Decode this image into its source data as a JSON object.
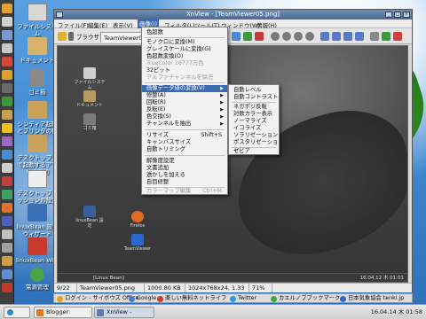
{
  "desktop": {
    "icons": [
      {
        "label": "ファイルシステム",
        "color": "#d8d8d8"
      },
      {
        "label": "ドキュメント",
        "color": "#d6b26b"
      },
      {
        "label": "ゴミ箱",
        "color": "#8a8a8a"
      },
      {
        "label": "シンティア起動とプリンタの接続",
        "color": "#c9a15a"
      },
      {
        "label": "デスクトップ上で起動するアプリの追加",
        "color": "#c9a15a"
      },
      {
        "label": "デスクトップセッションの設定",
        "color": "#eeeeee"
      },
      {
        "label": "linuxBean 設定ウィザード",
        "color": "#3b6fb6"
      },
      {
        "label": "linuxBean Wiki",
        "color": "#c83a2c"
      },
      {
        "label": "電源管理",
        "color": "#4aa344"
      }
    ]
  },
  "window": {
    "title": "XnView - [TeamViewer05.png]",
    "menus": [
      "ファイル(F)",
      "編集(E)",
      "表示(V)",
      "画像(I)",
      "フィルタ(L)",
      "ツール(T)",
      "ウィンドウ(W)",
      "情報(H)"
    ],
    "tabs": [
      "ブラウザ",
      "TeamViewer05"
    ],
    "status": {
      "index": "9/22",
      "filename": "TeamViewer05.png",
      "filesize": "1000.80 KB",
      "dimensions": "1024x768x24, 1.33",
      "zoom": "71%"
    }
  },
  "image_menu": {
    "items": [
      {
        "label": "色超数",
        "type": "normal"
      },
      {
        "label": "モノクロに変換(M)",
        "type": "normal"
      },
      {
        "label": "グレイスケールに変換(G)",
        "type": "normal"
      },
      {
        "label": "色超数変換(O)",
        "type": "normal"
      },
      {
        "label": "TrueColor 16777万色",
        "type": "disabled"
      },
      {
        "label": "32ビット",
        "type": "normal"
      },
      {
        "label": "アルファチャンネルを除去",
        "type": "disabled"
      },
      {
        "label": "画像データ値の変換(V)",
        "type": "highlight",
        "arrow": true
      },
      {
        "label": "修整(A)",
        "type": "normal",
        "arrow": true
      },
      {
        "label": "回転(R)",
        "type": "normal",
        "arrow": true
      },
      {
        "label": "反転(E)",
        "type": "normal",
        "arrow": true
      },
      {
        "label": "色交換(S)",
        "type": "normal",
        "arrow": true
      },
      {
        "label": "チャンネルを抽出",
        "type": "normal",
        "arrow": true
      },
      {
        "label": "リサイズ",
        "type": "normal",
        "shortcut": "Shift+S"
      },
      {
        "label": "キャンバスサイズ",
        "type": "normal"
      },
      {
        "label": "自動トリミング",
        "type": "normal"
      },
      {
        "label": "解像度設定",
        "type": "normal"
      },
      {
        "label": "文書追加",
        "type": "normal"
      },
      {
        "label": "透かしを加える",
        "type": "normal"
      },
      {
        "label": "自目修整",
        "type": "normal"
      },
      {
        "label": "カラーマップ編集",
        "type": "disabled",
        "shortcut": "Ctrl+M"
      }
    ]
  },
  "sub_menu": {
    "items": [
      "自動レベル",
      "自動コントラスト",
      "ネガポジ反転",
      "対数カラー表示",
      "ノーマライズ",
      "イコライズ",
      "ソラリゼーション",
      "ポスタリゼーション",
      "セピア"
    ]
  },
  "bookmarks": [
    {
      "label": "ログイン - サイボウズ Office",
      "color": "#e0a020"
    },
    {
      "label": "Google",
      "color": "#4a7ad8"
    },
    {
      "label": "楽しい無料ネットライフ",
      "color": "#d03a2a"
    },
    {
      "label": "Twitter",
      "color": "#2a9be0"
    },
    {
      "label": "カエルノブブックマーク...",
      "color": "#3caa3a"
    },
    {
      "label": "日本気象協会 tenki.jp",
      "color": "#2a6ad0"
    }
  ],
  "panel": {
    "tasks": [
      {
        "label": "Blogger: PuppyLin...",
        "color": "#e07a20"
      },
      {
        "label": "XnView - [TeamV...",
        "color": "#5a7ab0"
      }
    ],
    "clock": "16.04.14 木 01:58"
  },
  "inner_screen": {
    "icons": [
      "ファイルシステム",
      "ドキュメント",
      "ゴミ箱",
      "linuxBean 設定",
      "TeamViewer",
      "Firefox"
    ],
    "taskbar_text": "[Linux Bean]",
    "clock": "16.04.12 木 01:01"
  }
}
